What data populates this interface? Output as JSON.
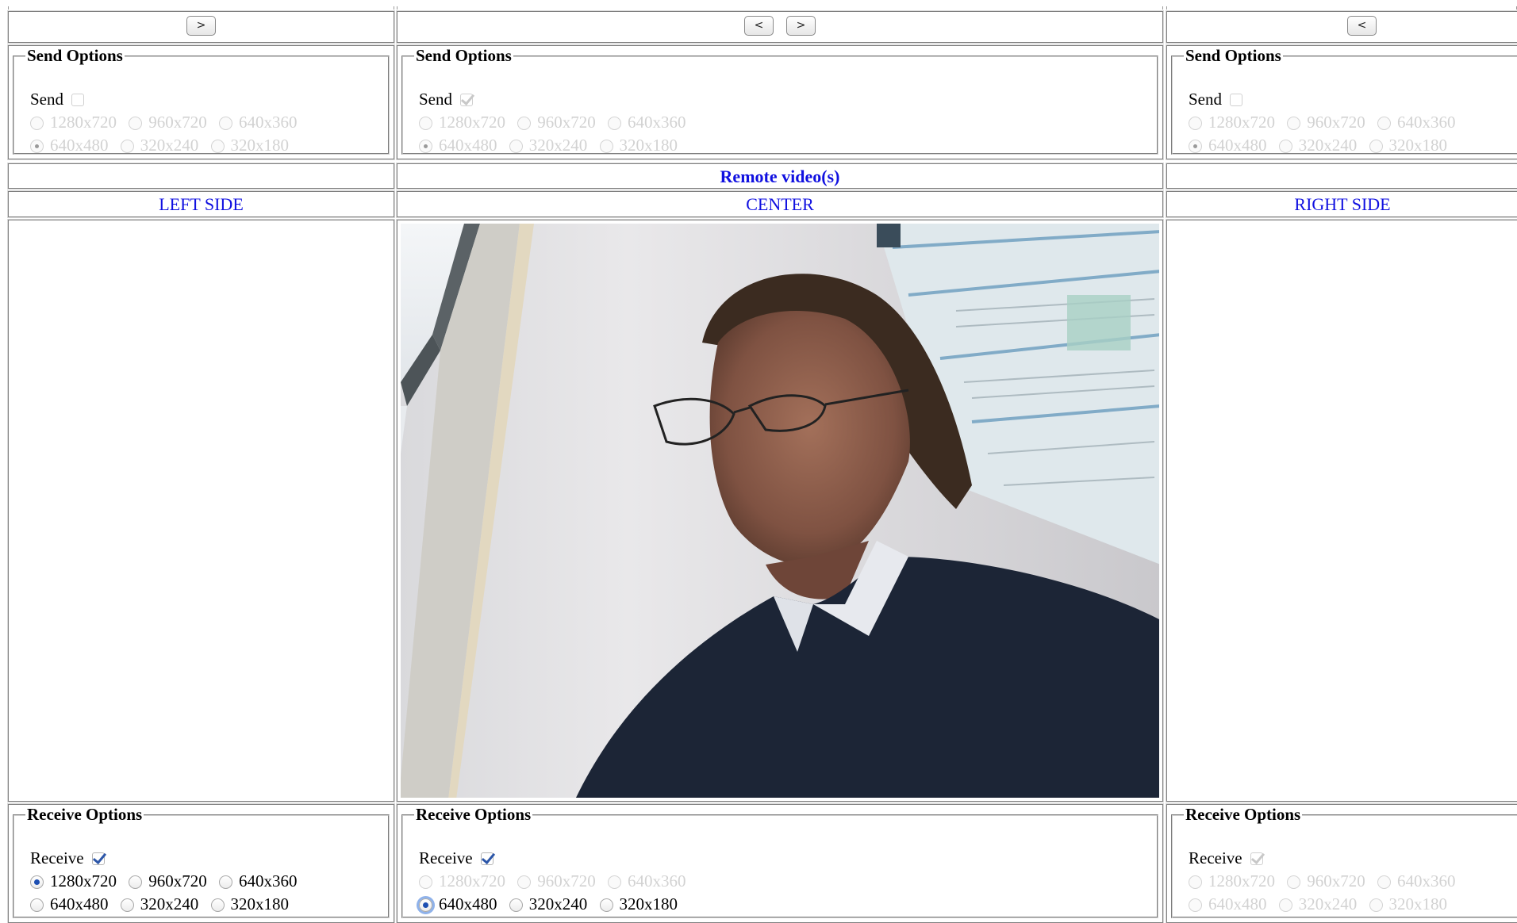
{
  "nav": {
    "left_next": ">",
    "center_prev": "<",
    "center_next": ">",
    "right_prev": "<"
  },
  "send": {
    "legend": "Send Options",
    "label": "Send",
    "resolutions_row1": [
      "1280x720",
      "960x720",
      "640x360"
    ],
    "resolutions_row2": [
      "640x480",
      "320x240",
      "320x180"
    ],
    "panels": [
      {
        "checked": false,
        "selected": "640x480",
        "enabled": false
      },
      {
        "checked": true,
        "selected": "640x480",
        "enabled": false
      },
      {
        "checked": false,
        "selected": "640x480",
        "enabled": false
      }
    ]
  },
  "headers": {
    "remote": "Remote video(s)",
    "left": "LEFT SIDE",
    "center": "CENTER",
    "right": "RIGHT SIDE"
  },
  "receive": {
    "legend": "Receive Options",
    "label": "Receive",
    "resolutions_row1": [
      "1280x720",
      "960x720",
      "640x360"
    ],
    "resolutions_row2": [
      "640x480",
      "320x240",
      "320x180"
    ],
    "panels": [
      {
        "checked": true,
        "selected": "1280x720",
        "enabled": true
      },
      {
        "checked": true,
        "selected": "640x480",
        "enabled": "row2"
      },
      {
        "checked": true,
        "selected": "",
        "enabled": false
      }
    ]
  },
  "colors": {
    "header_blue": "#1010e0",
    "radio_blue": "#1d4fb2",
    "disabled_text": "#d2d2d2"
  }
}
